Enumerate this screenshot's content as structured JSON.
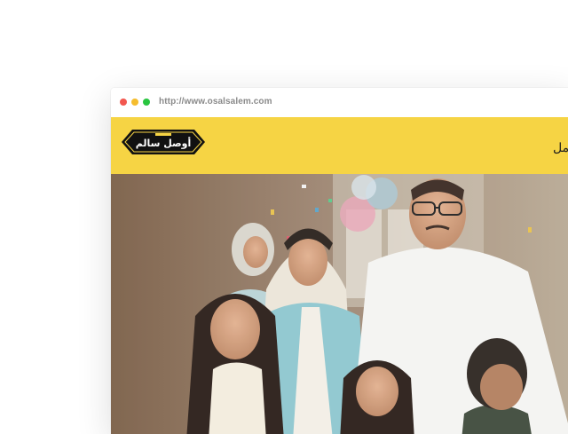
{
  "browser": {
    "url": "http://www.osalsalem.com",
    "controls": [
      "close",
      "minimize",
      "maximize"
    ]
  },
  "header": {
    "logo_text": "أوصل سالم",
    "nav_label": "مل"
  },
  "hero": {
    "image": "family-celebration-photo"
  },
  "colors": {
    "header_bg": "#f6d444",
    "close": "#f2574f",
    "minimize": "#f5bd2e",
    "maximize": "#29c540"
  }
}
